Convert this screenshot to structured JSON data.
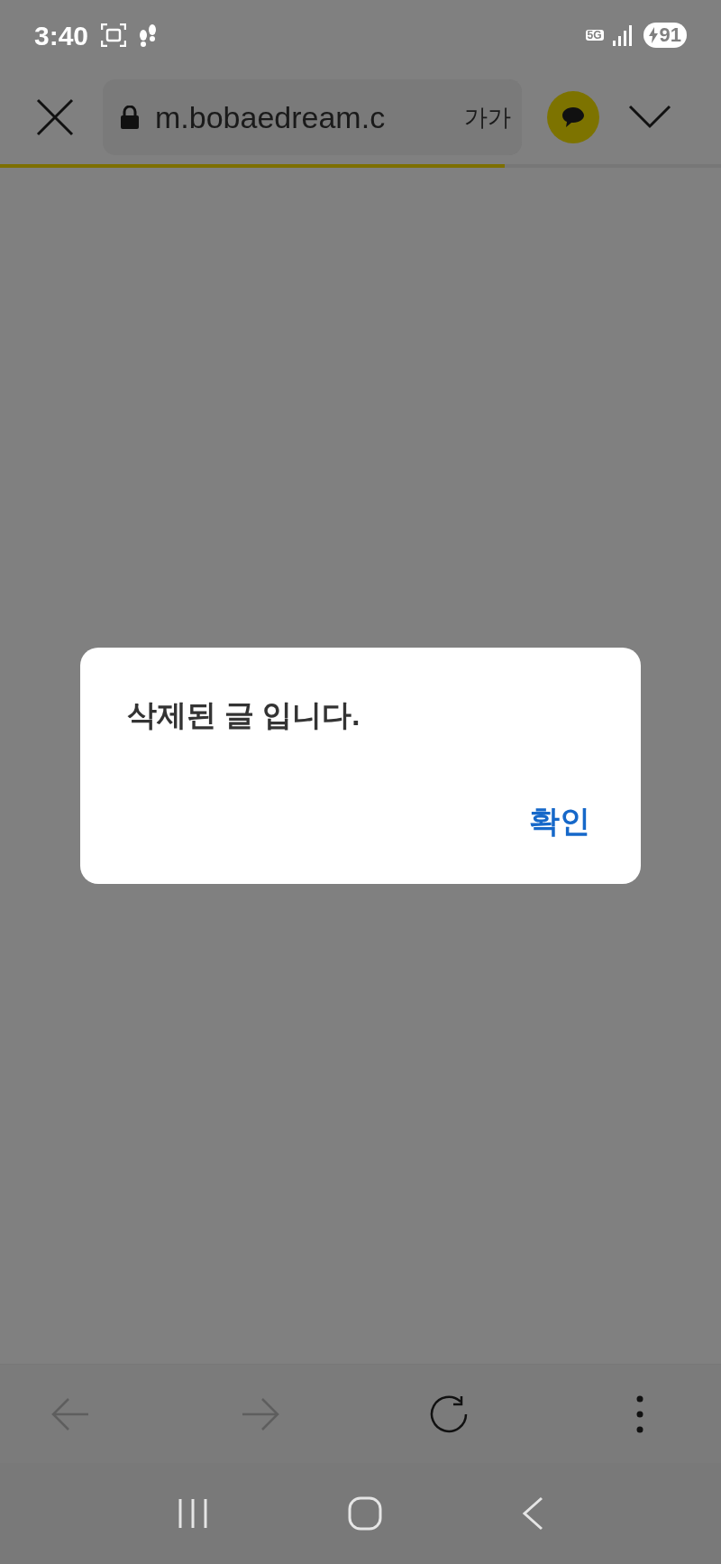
{
  "status_bar": {
    "time": "3:40",
    "network": "5G",
    "battery": "91"
  },
  "browser_toolbar": {
    "url": "m.bobaedream.c",
    "text_size_button": "가가",
    "load_progress": {
      "level": 0.7
    }
  },
  "dialog": {
    "message": "삭제된 글 입니다.",
    "buttons": [
      {
        "label": "확인"
      }
    ]
  },
  "bottom_toolbar": [
    {
      "kind": "back",
      "disabled": true
    },
    {
      "kind": "forward",
      "disabled": true
    },
    {
      "kind": "reload",
      "disabled": false
    },
    {
      "kind": "menu",
      "disabled": false
    }
  ]
}
